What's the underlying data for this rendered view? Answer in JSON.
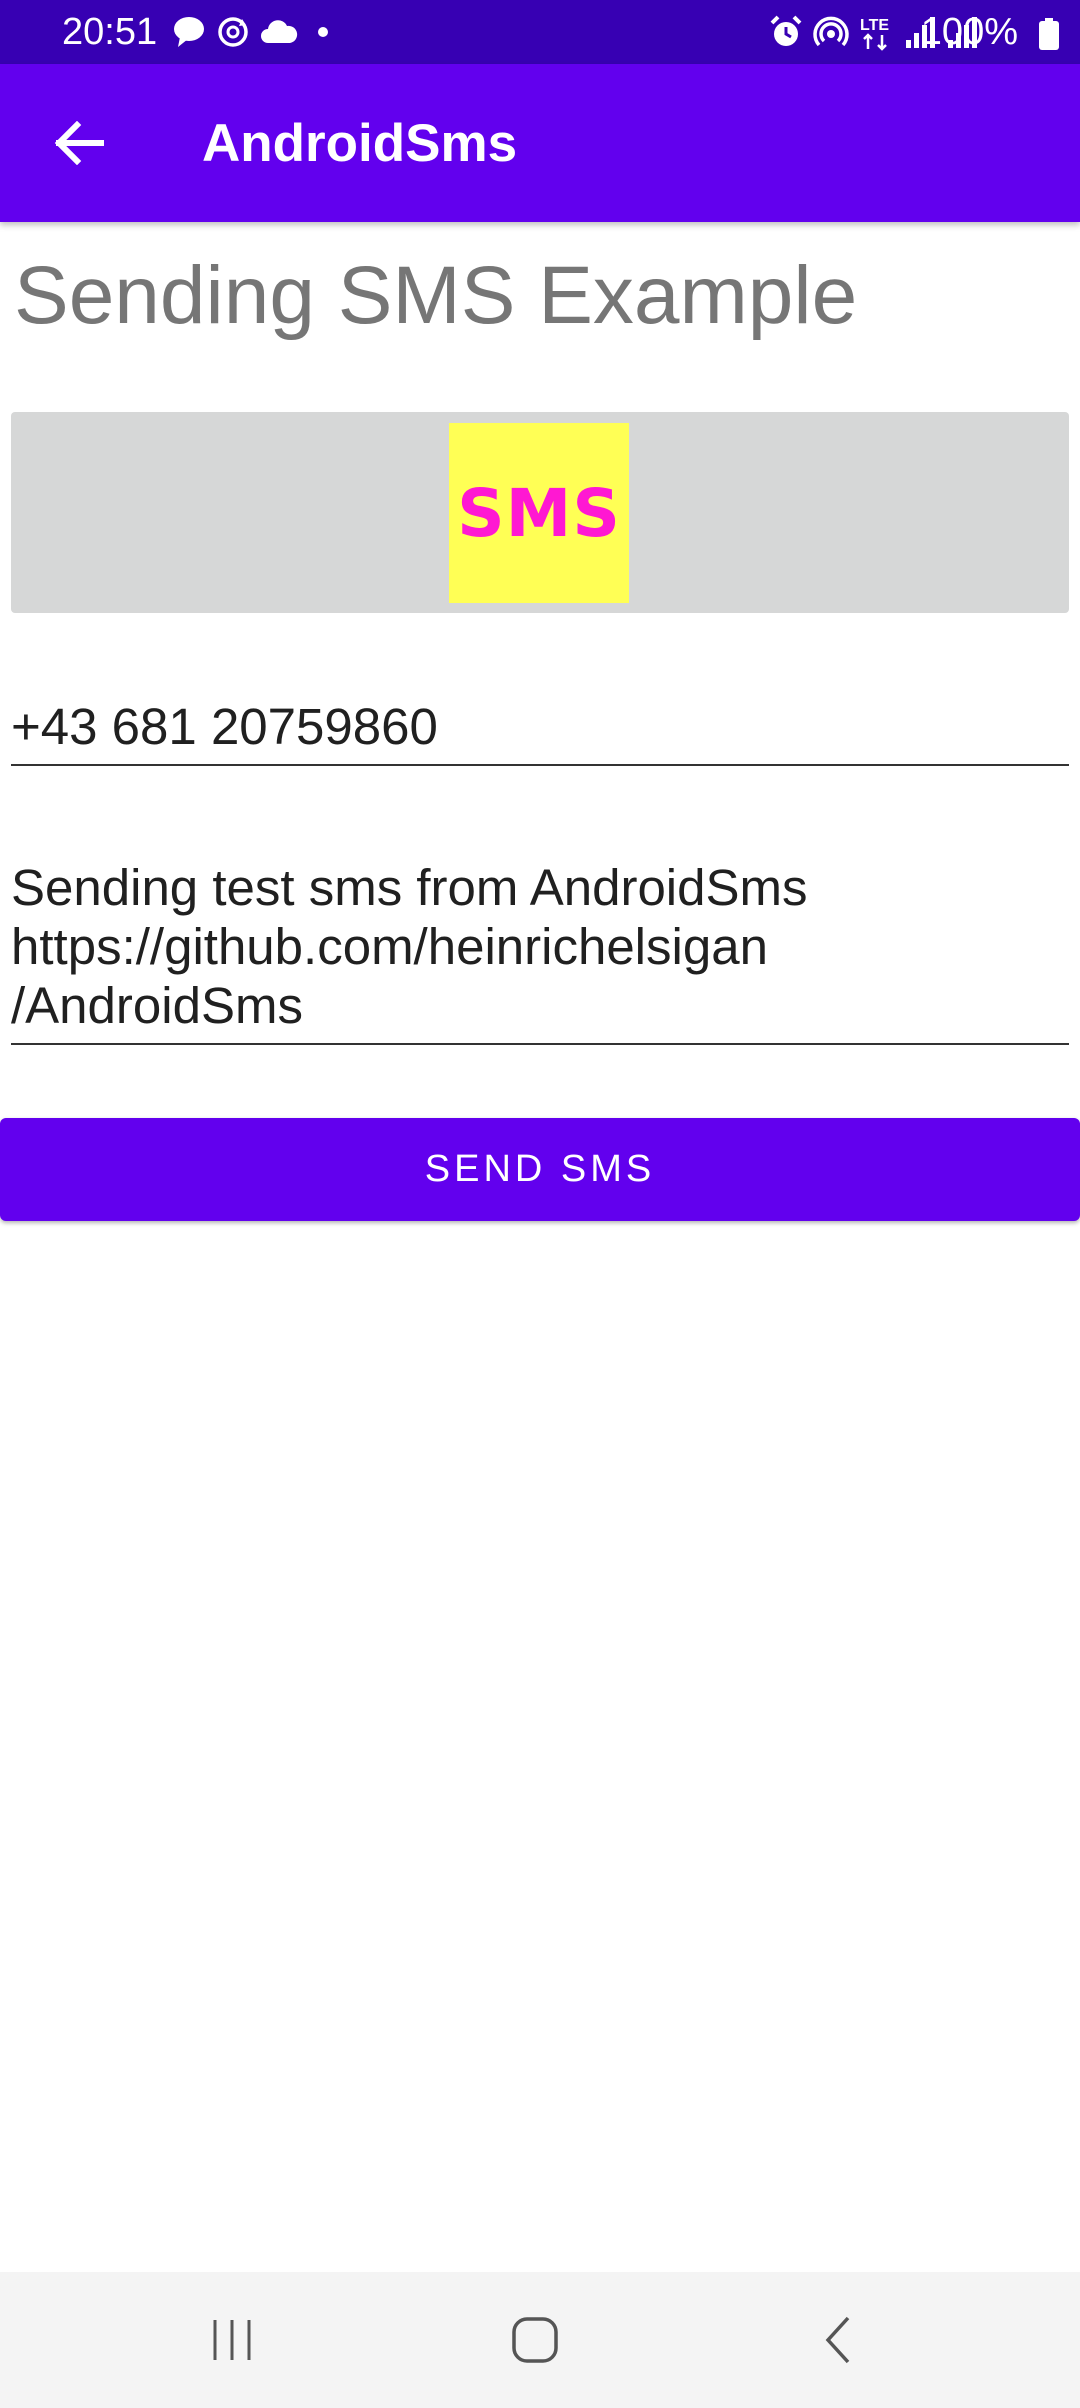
{
  "status_bar": {
    "time": "20:51",
    "battery": "100%",
    "left_icons": [
      "chat-bubble-icon",
      "sync-icon",
      "cloud-icon",
      "dot-icon"
    ],
    "right_icons": [
      "alarm-icon",
      "hotspot-icon",
      "lte-icon",
      "signal-icon",
      "signal-icon",
      "battery-icon"
    ],
    "network_label": "LTE"
  },
  "app_bar": {
    "title": "AndroidSms",
    "back_icon": "arrow-back-icon",
    "background": "#6200ee"
  },
  "main": {
    "heading": "Sending SMS Example",
    "image": {
      "text": "SMS",
      "background": "#ffff55",
      "text_color": "#ff18d2"
    },
    "phone_number": "+43 681 20759860",
    "message": "Sending test sms from AndroidSms\nhttps://github.com/heinrichelsigan\n/AndroidSms",
    "send_button_label": "SEND SMS"
  },
  "nav_bar": {
    "buttons": [
      "recent-apps-icon",
      "home-icon",
      "back-icon"
    ]
  },
  "colors": {
    "primary": "#6200ee",
    "primary_dark": "#3700b3"
  }
}
